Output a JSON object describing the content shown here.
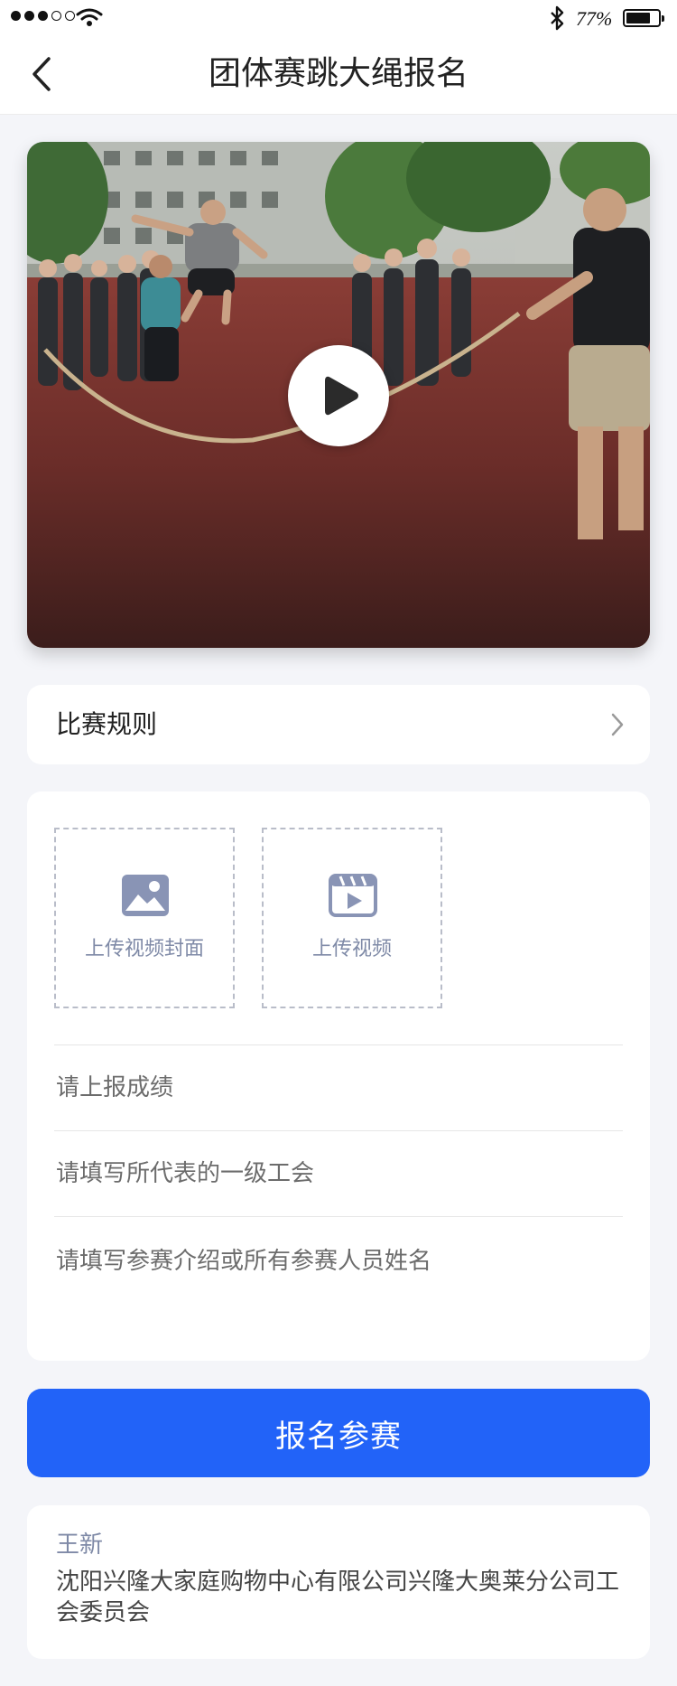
{
  "status_bar": {
    "battery_percent": "77%",
    "battery_level": 0.77
  },
  "nav": {
    "title": "团体赛跳大绳报名"
  },
  "rules": {
    "label": "比赛规则"
  },
  "upload": {
    "cover_label": "上传视频封面",
    "video_label": "上传视频"
  },
  "form": {
    "score_placeholder": "请上报成绩",
    "union_placeholder": "请填写所代表的一级工会",
    "intro_placeholder": "请填写参赛介绍或所有参赛人员姓名"
  },
  "submit": {
    "label": "报名参赛"
  },
  "info": {
    "name": "王新",
    "organization": "沈阳兴隆大家庭购物中心有限公司兴隆大奥莱分公司工会委员会"
  },
  "colors": {
    "accent": "#2263f8",
    "muted_label": "#7f8aa7",
    "background": "#f4f5f9"
  },
  "icons": {
    "back": "chevron-left-icon",
    "rules": "chevron-right-icon",
    "cover": "image-icon",
    "video": "clapperboard-play-icon",
    "play": "play-icon"
  }
}
